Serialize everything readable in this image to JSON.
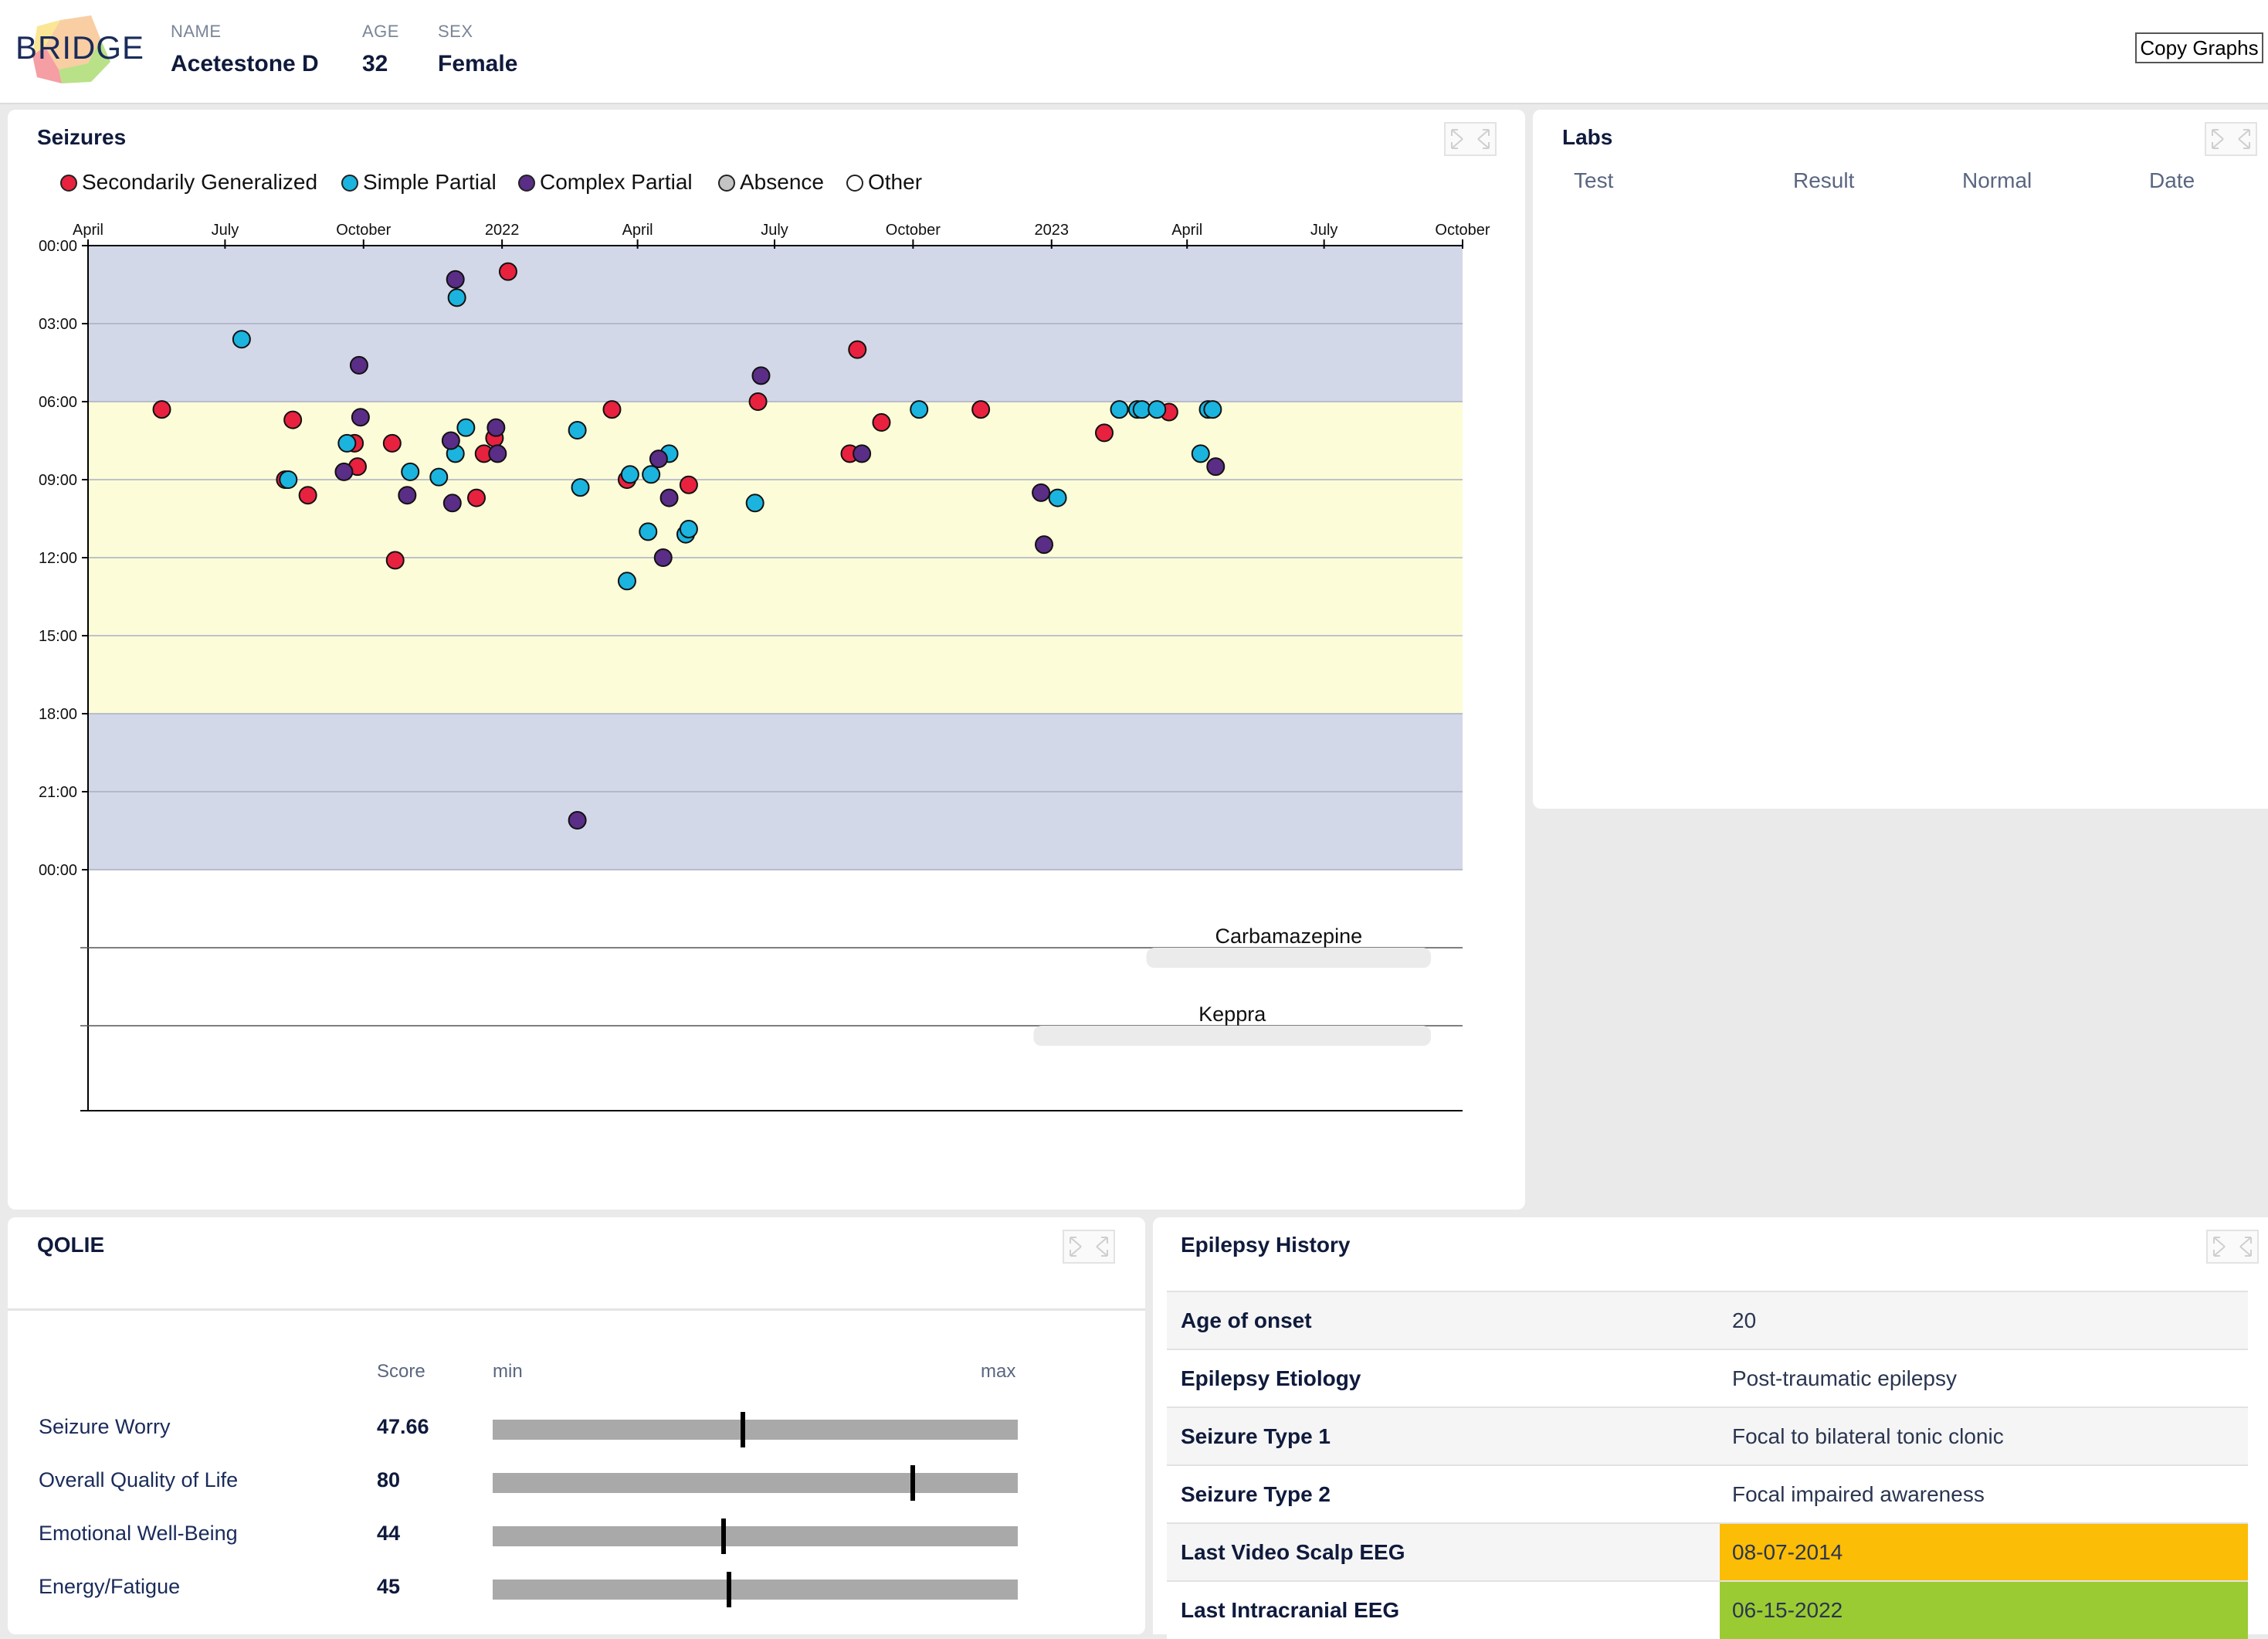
{
  "header": {
    "logo_text": "BRIDGE",
    "name_label": "NAME",
    "name": "Acetestone D",
    "age_label": "AGE",
    "age": "32",
    "sex_label": "SEX",
    "sex": "Female",
    "copy_graphs": "Copy Graphs"
  },
  "seizures": {
    "title": "Seizures",
    "legend": [
      {
        "label": "Secondarily Generalized",
        "color": "#e8213f"
      },
      {
        "label": "Simple Partial",
        "color": "#1ab4df"
      },
      {
        "label": "Complex Partial",
        "color": "#5a2d86"
      },
      {
        "label": "Absence",
        "color": "#c4c4c4"
      },
      {
        "label": "Other",
        "color": "#ffffff"
      }
    ],
    "medications": [
      {
        "name": "Carbamazepine",
        "start": "2023-03-05",
        "end": "2023-09-10"
      },
      {
        "name": "Keppra",
        "start": "2022-12-20",
        "end": "2023-09-10"
      }
    ]
  },
  "chart_data": {
    "type": "scatter",
    "x_ticks": [
      "April",
      "July",
      "October",
      "2022",
      "April",
      "July",
      "October",
      "2023",
      "April",
      "July",
      "October"
    ],
    "x_tick_dates": [
      "2021-04-01",
      "2021-07-01",
      "2021-10-01",
      "2022-01-01",
      "2022-04-01",
      "2022-07-01",
      "2022-10-01",
      "2023-01-01",
      "2023-04-01",
      "2023-07-01",
      "2023-10-01"
    ],
    "y_ticks": [
      "00:00",
      "03:00",
      "06:00",
      "09:00",
      "12:00",
      "15:00",
      "18:00",
      "21:00",
      "00:00"
    ],
    "xlim": [
      "2021-04-01",
      "2023-10-01"
    ],
    "ylim": [
      0,
      24
    ],
    "y_direction": "down",
    "day_band": [
      6,
      18
    ],
    "colors": {
      "night": "#d3d8e8",
      "day": "#fcfcd8"
    },
    "series": [
      {
        "name": "Secondarily Generalized",
        "color": "#e8213f",
        "points": [
          [
            "2021-05-20",
            6.3
          ],
          [
            "2021-08-10",
            9.0
          ],
          [
            "2021-08-15",
            6.7
          ],
          [
            "2021-08-25",
            9.6
          ],
          [
            "2021-09-25",
            7.6
          ],
          [
            "2021-09-27",
            8.5
          ],
          [
            "2021-10-20",
            7.6
          ],
          [
            "2021-10-22",
            12.1
          ],
          [
            "2021-12-15",
            9.7
          ],
          [
            "2021-12-20",
            8.0
          ],
          [
            "2021-12-27",
            7.4
          ],
          [
            "2022-01-05",
            1.0
          ],
          [
            "2022-03-15",
            6.3
          ],
          [
            "2022-03-25",
            9.0
          ],
          [
            "2022-05-05",
            9.2
          ],
          [
            "2022-06-20",
            6.0
          ],
          [
            "2022-08-20",
            8.0
          ],
          [
            "2022-08-25",
            4.0
          ],
          [
            "2022-09-10",
            6.8
          ],
          [
            "2022-11-15",
            6.3
          ],
          [
            "2023-02-05",
            7.2
          ],
          [
            "2023-03-20",
            6.4
          ]
        ]
      },
      {
        "name": "Simple Partial",
        "color": "#1ab4df",
        "points": [
          [
            "2021-07-12",
            3.6
          ],
          [
            "2021-08-12",
            9.0
          ],
          [
            "2021-09-20",
            7.6
          ],
          [
            "2021-11-01",
            8.7
          ],
          [
            "2021-11-20",
            8.9
          ],
          [
            "2021-12-01",
            8.0
          ],
          [
            "2021-12-02",
            2.0
          ],
          [
            "2021-12-08",
            7.0
          ],
          [
            "2022-02-20",
            7.1
          ],
          [
            "2022-02-22",
            9.3
          ],
          [
            "2022-03-25",
            12.9
          ],
          [
            "2022-03-27",
            8.8
          ],
          [
            "2022-04-08",
            11.0
          ],
          [
            "2022-04-10",
            8.8
          ],
          [
            "2022-04-22",
            8.0
          ],
          [
            "2022-05-03",
            11.1
          ],
          [
            "2022-05-05",
            10.9
          ],
          [
            "2022-06-18",
            9.9
          ],
          [
            "2022-10-05",
            6.3
          ],
          [
            "2023-01-05",
            9.7
          ],
          [
            "2023-02-15",
            6.3
          ],
          [
            "2023-02-27",
            6.3
          ],
          [
            "2023-03-02",
            6.3
          ],
          [
            "2023-03-12",
            6.3
          ],
          [
            "2023-04-10",
            8.0
          ],
          [
            "2023-04-15",
            6.3
          ],
          [
            "2023-04-18",
            6.3
          ]
        ]
      },
      {
        "name": "Complex Partial",
        "color": "#5a2d86",
        "points": [
          [
            "2021-09-18",
            8.7
          ],
          [
            "2021-09-28",
            4.6
          ],
          [
            "2021-09-29",
            6.6
          ],
          [
            "2021-10-30",
            9.6
          ],
          [
            "2021-11-28",
            7.5
          ],
          [
            "2021-11-29",
            9.9
          ],
          [
            "2021-12-01",
            1.3
          ],
          [
            "2021-12-28",
            7.0
          ],
          [
            "2021-12-29",
            8.0
          ],
          [
            "2022-02-20",
            22.1
          ],
          [
            "2022-04-15",
            8.2
          ],
          [
            "2022-04-18",
            12.0
          ],
          [
            "2022-04-22",
            9.7
          ],
          [
            "2022-06-22",
            5.0
          ],
          [
            "2022-08-28",
            8.0
          ],
          [
            "2022-12-25",
            9.5
          ],
          [
            "2022-12-27",
            11.5
          ],
          [
            "2023-04-20",
            8.5
          ]
        ]
      }
    ]
  },
  "labs": {
    "title": "Labs",
    "columns": [
      "Test",
      "Result",
      "Normal",
      "Date"
    ]
  },
  "qolie": {
    "title": "QOLIE",
    "score_header": "Score",
    "min_label": "min",
    "max_label": "max",
    "rows": [
      {
        "label": "Seizure Worry",
        "score": "47.66",
        "value": 47.66
      },
      {
        "label": "Overall Quality of Life",
        "score": "80",
        "value": 80
      },
      {
        "label": "Emotional Well-Being",
        "score": "44",
        "value": 44
      },
      {
        "label": "Energy/Fatigue",
        "score": "45",
        "value": 45
      }
    ]
  },
  "history": {
    "title": "Epilepsy History",
    "rows": [
      {
        "key": "Age of onset",
        "value": "20",
        "highlight": ""
      },
      {
        "key": "Epilepsy Etiology",
        "value": "Post-traumatic epilepsy",
        "highlight": ""
      },
      {
        "key": "Seizure Type 1",
        "value": "Focal to bilateral tonic clonic",
        "highlight": ""
      },
      {
        "key": "Seizure Type 2",
        "value": "Focal impaired awareness",
        "highlight": ""
      },
      {
        "key": "Last Video Scalp EEG",
        "value": "08-07-2014",
        "highlight": "#fbbd05"
      },
      {
        "key": "Last Intracranial EEG",
        "value": "06-15-2022",
        "highlight": "#9bcb32"
      }
    ]
  }
}
